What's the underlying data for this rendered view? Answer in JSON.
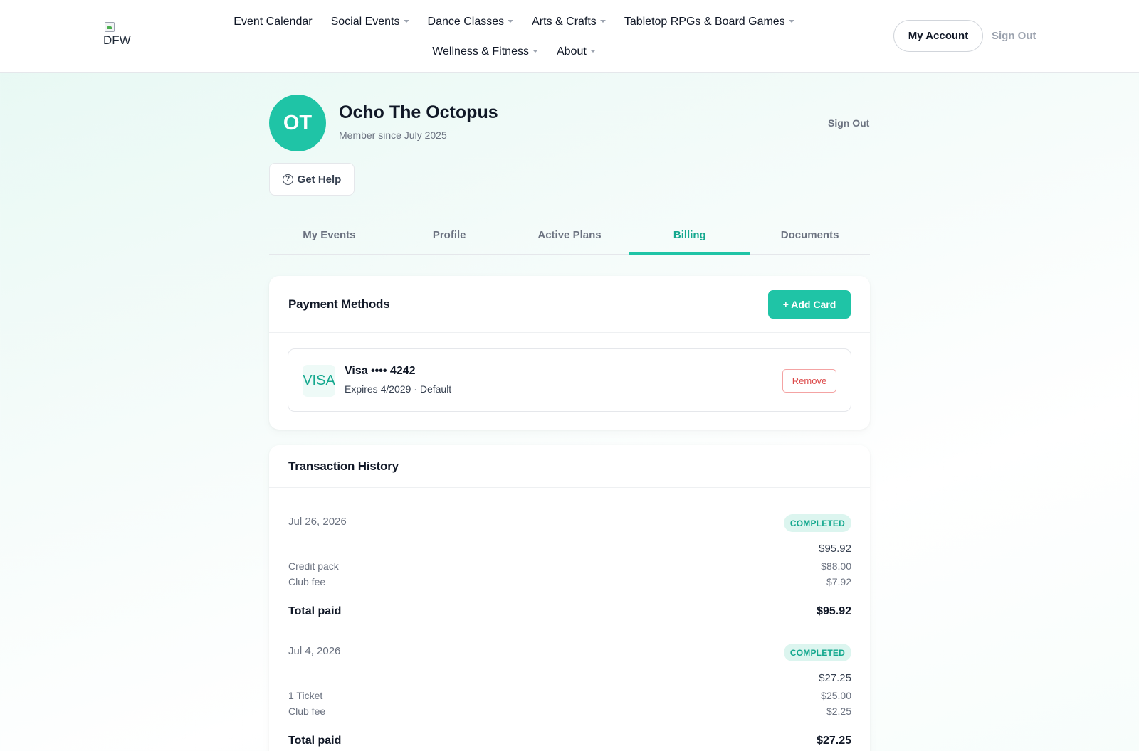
{
  "nav": {
    "logo_alt": "DFW",
    "items": [
      {
        "label": "Event Calendar",
        "has_dropdown": false
      },
      {
        "label": "Social Events",
        "has_dropdown": true
      },
      {
        "label": "Dance Classes",
        "has_dropdown": true
      },
      {
        "label": "Arts & Crafts",
        "has_dropdown": true
      },
      {
        "label": "Tabletop RPGs & Board Games",
        "has_dropdown": true
      },
      {
        "label": "Wellness & Fitness",
        "has_dropdown": true
      },
      {
        "label": "About",
        "has_dropdown": true
      }
    ],
    "account_label": "My Account",
    "signout_label": "Sign Out"
  },
  "profile": {
    "initials": "OT",
    "name": "Ocho The Octopus",
    "member_since": "Member since July 2025",
    "signout_label": "Sign Out",
    "help_label": "Get Help"
  },
  "tabs": [
    {
      "label": "My Events",
      "active": false
    },
    {
      "label": "Profile",
      "active": false
    },
    {
      "label": "Active Plans",
      "active": false
    },
    {
      "label": "Billing",
      "active": true
    },
    {
      "label": "Documents",
      "active": false
    }
  ],
  "payment_methods": {
    "title": "Payment Methods",
    "add_label": "+ Add Card",
    "card": {
      "brand_logo": "VISA",
      "label": "Visa •••• 4242",
      "expiry": "Expires 4/2029 · Default",
      "remove_label": "Remove"
    }
  },
  "transactions": {
    "title": "Transaction History",
    "items": [
      {
        "date": "Jul 26, 2026",
        "status": "COMPLETED",
        "amount": "$95.92",
        "lines": [
          {
            "label": "Credit pack",
            "amount": "$88.00"
          },
          {
            "label": "Club fee",
            "amount": "$7.92"
          }
        ],
        "total_label": "Total paid",
        "total": "$95.92"
      },
      {
        "date": "Jul 4, 2026",
        "status": "COMPLETED",
        "amount": "$27.25",
        "lines": [
          {
            "label": "1 Ticket",
            "amount": "$25.00"
          },
          {
            "label": "Club fee",
            "amount": "$2.25"
          }
        ],
        "total_label": "Total paid",
        "total": "$27.25"
      }
    ]
  },
  "colors": {
    "accent": "#1fc4a6",
    "accent_text": "#14a88e",
    "danger": "#dc4848"
  }
}
